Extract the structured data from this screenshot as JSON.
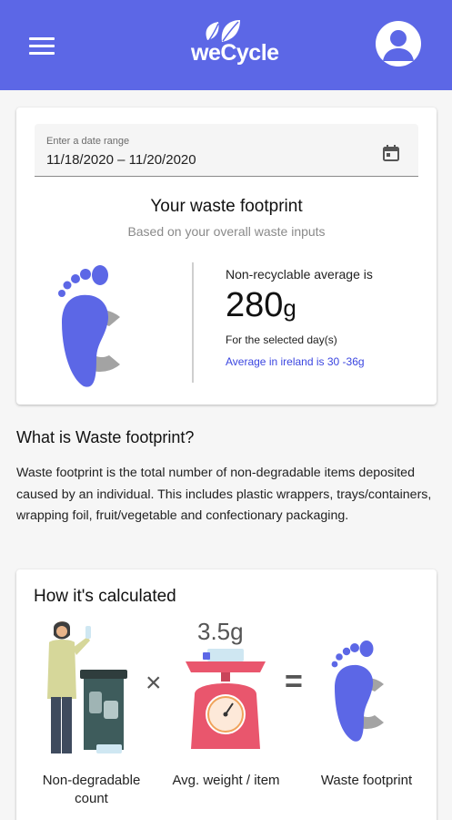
{
  "header": {
    "logo_text": "weCycle",
    "menu_icon": "hamburger-menu-icon",
    "profile_icon": "account-circle-icon",
    "bg_color": "#5c67e6"
  },
  "date_range": {
    "label": "Enter a date range",
    "value": "11/18/2020 – 11/20/2020",
    "icon": "calendar-icon"
  },
  "footprint": {
    "title": "Your waste footprint",
    "subtitle": "Based on your overall waste inputs",
    "nr_label": "Non-recyclable average is",
    "value": "280",
    "unit": "g",
    "period_note": "For the selected day(s)",
    "average_link": "Average in ireland is 30 -36g",
    "link_color": "#3b46e0"
  },
  "info": {
    "heading": "What is Waste footprint?",
    "body": "Waste footprint is the total number of non-degradable items deposited caused by an individual. This includes plastic wrappers, trays/containers, wrapping foil, fruit/vegetable and confectionary packaging."
  },
  "calculation": {
    "title": "How it's calculated",
    "weight": "3.5g",
    "times_symbol": "×",
    "equals_symbol": "=",
    "captions": [
      "Non-degradable count",
      "Avg. weight / item",
      "Waste footprint"
    ]
  }
}
